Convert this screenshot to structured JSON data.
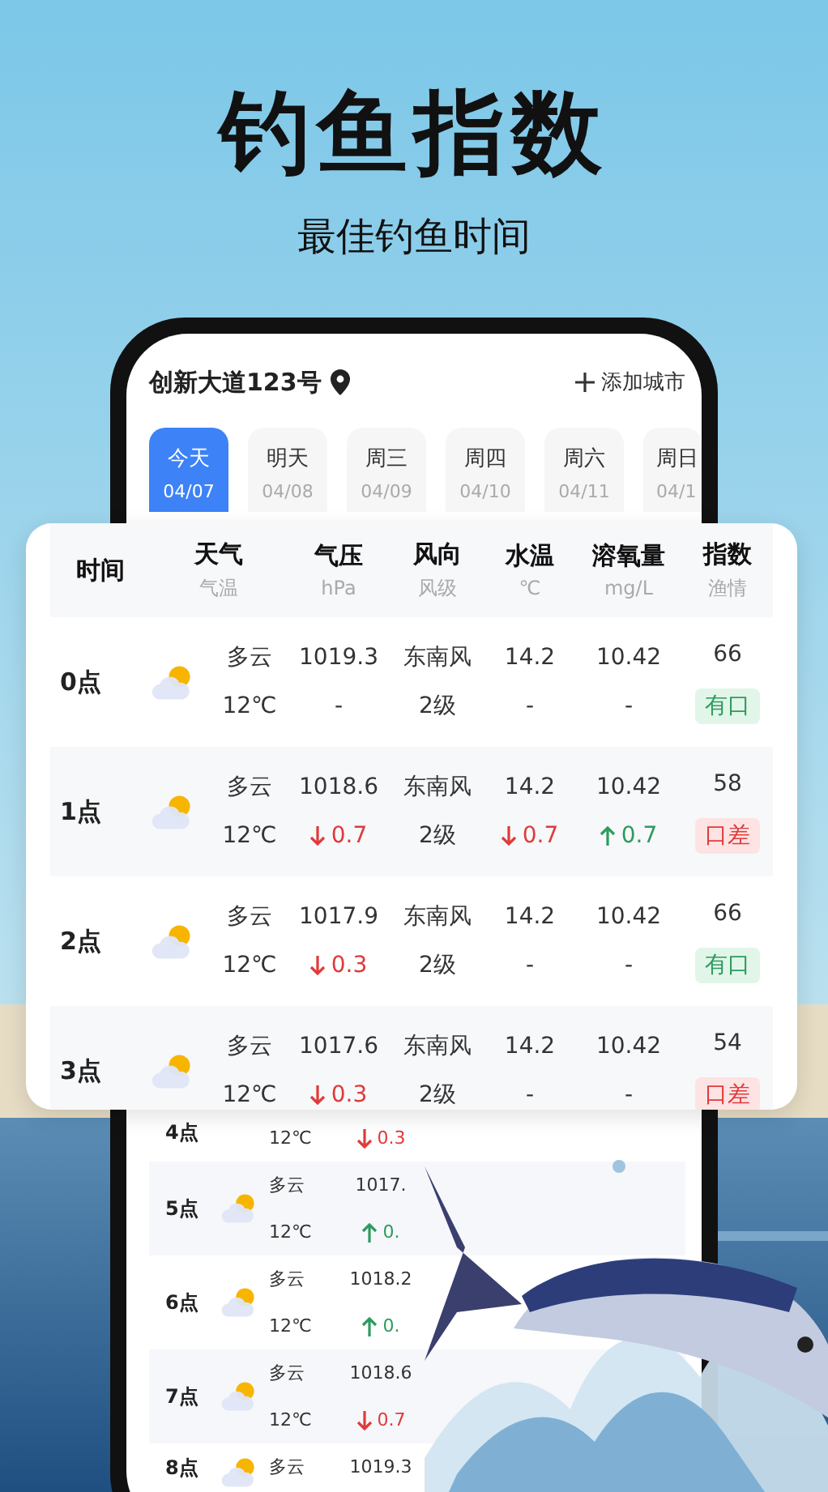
{
  "headline": {
    "title": "钓鱼指数",
    "subtitle": "最佳钓鱼时间"
  },
  "location": {
    "name": "创新大道123号",
    "add_city": "添加城市"
  },
  "days": [
    {
      "label": "今天",
      "date": "04/07",
      "selected": true
    },
    {
      "label": "明天",
      "date": "04/08",
      "selected": false
    },
    {
      "label": "周三",
      "date": "04/09",
      "selected": false
    },
    {
      "label": "周四",
      "date": "04/10",
      "selected": false
    },
    {
      "label": "周六",
      "date": "04/11",
      "selected": false
    },
    {
      "label": "周日",
      "date": "04/1",
      "selected": false
    }
  ],
  "table": {
    "columns": [
      {
        "title": "时间"
      },
      {
        "title": "天气",
        "unit": "气温"
      },
      {
        "title": "气压",
        "unit": "hPa"
      },
      {
        "title": "风向",
        "unit": "风级"
      },
      {
        "title": "水温",
        "unit": "℃"
      },
      {
        "title": "溶氧量",
        "unit": "mg/L"
      },
      {
        "title": "指数",
        "unit": "渔情"
      }
    ],
    "rows": [
      {
        "time": "0点",
        "weather": "多云",
        "temp": "12℃",
        "pressure": "1019.3",
        "pressure_change": {
          "text": "-"
        },
        "wind": "东南风",
        "wind_level": "2级",
        "water": "14.2",
        "water_change": {
          "text": "-"
        },
        "oxygen": "10.42",
        "oxygen_change": {
          "text": "-"
        },
        "index": "66",
        "rating": {
          "text": "有口",
          "kind": "good"
        }
      },
      {
        "time": "1点",
        "weather": "多云",
        "temp": "12℃",
        "pressure": "1018.6",
        "pressure_change": {
          "text": "0.7",
          "kind": "down"
        },
        "wind": "东南风",
        "wind_level": "2级",
        "water": "14.2",
        "water_change": {
          "text": "0.7",
          "kind": "down"
        },
        "oxygen": "10.42",
        "oxygen_change": {
          "text": "0.7",
          "kind": "up"
        },
        "index": "58",
        "rating": {
          "text": "口差",
          "kind": "bad"
        }
      },
      {
        "time": "2点",
        "weather": "多云",
        "temp": "12℃",
        "pressure": "1017.9",
        "pressure_change": {
          "text": "0.3",
          "kind": "down"
        },
        "wind": "东南风",
        "wind_level": "2级",
        "water": "14.2",
        "water_change": {
          "text": "-"
        },
        "oxygen": "10.42",
        "oxygen_change": {
          "text": "-"
        },
        "index": "66",
        "rating": {
          "text": "有口",
          "kind": "good"
        }
      },
      {
        "time": "3点",
        "weather": "多云",
        "temp": "12℃",
        "pressure": "1017.6",
        "pressure_change": {
          "text": "0.3",
          "kind": "down"
        },
        "wind": "东南风",
        "wind_level": "2级",
        "water": "14.2",
        "water_change": {
          "text": "-"
        },
        "oxygen": "10.42",
        "oxygen_change": {
          "text": "-"
        },
        "index": "54",
        "rating": {
          "text": "口差",
          "kind": "bad"
        }
      }
    ]
  },
  "phone_rows": [
    {
      "time": "4点",
      "temp": "12℃",
      "pressure_change": {
        "text": "0.3",
        "kind": "down"
      }
    },
    {
      "time": "5点",
      "weather": "多云",
      "temp": "12℃",
      "pressure": "1017.",
      "pressure_change": {
        "text": "0.",
        "kind": "up"
      }
    },
    {
      "time": "6点",
      "weather": "多云",
      "temp": "12℃",
      "pressure": "1018.2",
      "pressure_change": {
        "text": "0.",
        "kind": "up"
      }
    },
    {
      "time": "7点",
      "weather": "多云",
      "temp": "12℃",
      "pressure": "1018.6",
      "pressure_change": {
        "text": "0.7",
        "kind": "down"
      }
    },
    {
      "time": "8点",
      "weather": "多云",
      "pressure": "1019.3"
    }
  ]
}
